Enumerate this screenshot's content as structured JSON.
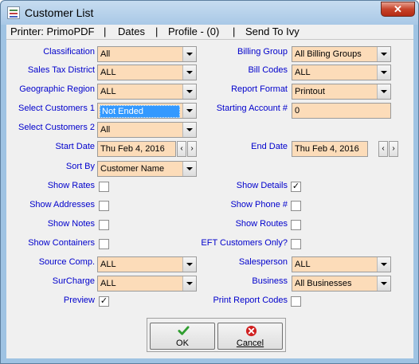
{
  "window": {
    "title": "Customer List",
    "close_symbol": "✕"
  },
  "menu": {
    "printer": "Printer: PrimoPDF",
    "dates": "Dates",
    "profile": "Profile - (0)",
    "send_to": "Send To Ivy",
    "separator": "|"
  },
  "form": {
    "classification": {
      "label": "Classification",
      "value": "All"
    },
    "sales_tax_district": {
      "label": "Sales Tax District",
      "value": "ALL"
    },
    "geographic_region": {
      "label": "Geographic Region",
      "value": "ALL"
    },
    "select_customers_1": {
      "label": "Select Customers 1",
      "value": "Not Ended"
    },
    "select_customers_2": {
      "label": "Select Customers 2",
      "value": "All"
    },
    "start_date": {
      "label": "Start Date",
      "value": "Thu Feb 4, 2016"
    },
    "sort_by": {
      "label": "Sort By",
      "value": "Customer Name"
    },
    "show_rates": {
      "label": "Show Rates",
      "checked": false
    },
    "show_addresses": {
      "label": "Show Addresses",
      "checked": false
    },
    "show_notes": {
      "label": "Show Notes",
      "checked": false
    },
    "show_containers": {
      "label": "Show Containers",
      "checked": false
    },
    "source_comp": {
      "label": "Source Comp.",
      "value": "ALL"
    },
    "surcharge": {
      "label": "SurCharge",
      "value": "ALL"
    },
    "preview": {
      "label": "Preview",
      "checked": true
    },
    "billing_group": {
      "label": "Billing Group",
      "value": "All Billing Groups"
    },
    "bill_codes": {
      "label": "Bill Codes",
      "value": "ALL"
    },
    "report_format": {
      "label": "Report Format",
      "value": "Printout"
    },
    "starting_account": {
      "label": "Starting Account #",
      "value": "0"
    },
    "end_date": {
      "label": "End Date",
      "value": "Thu Feb 4, 2016"
    },
    "show_details": {
      "label": "Show Details",
      "checked": true
    },
    "show_phone": {
      "label": "Show Phone #",
      "checked": false
    },
    "show_routes": {
      "label": "Show Routes",
      "checked": false
    },
    "eft_only": {
      "label": "EFT Customers Only?",
      "checked": false
    },
    "salesperson": {
      "label": "Salesperson",
      "value": "ALL"
    },
    "business": {
      "label": "Business",
      "value": "All Businesses"
    },
    "print_report_codes": {
      "label": "Print Report Codes",
      "checked": false
    }
  },
  "spin": {
    "prev": "‹",
    "next": "›"
  },
  "check_mark": "✓",
  "buttons": {
    "ok": {
      "label": "OK"
    },
    "cancel": {
      "label": "Cancel"
    }
  },
  "colors": {
    "label_blue": "#0000cc",
    "field_bg": "#fcdcb9",
    "selection": "#3399ff",
    "ok_green": "#2f9e2f",
    "cancel_red": "#d02020"
  }
}
